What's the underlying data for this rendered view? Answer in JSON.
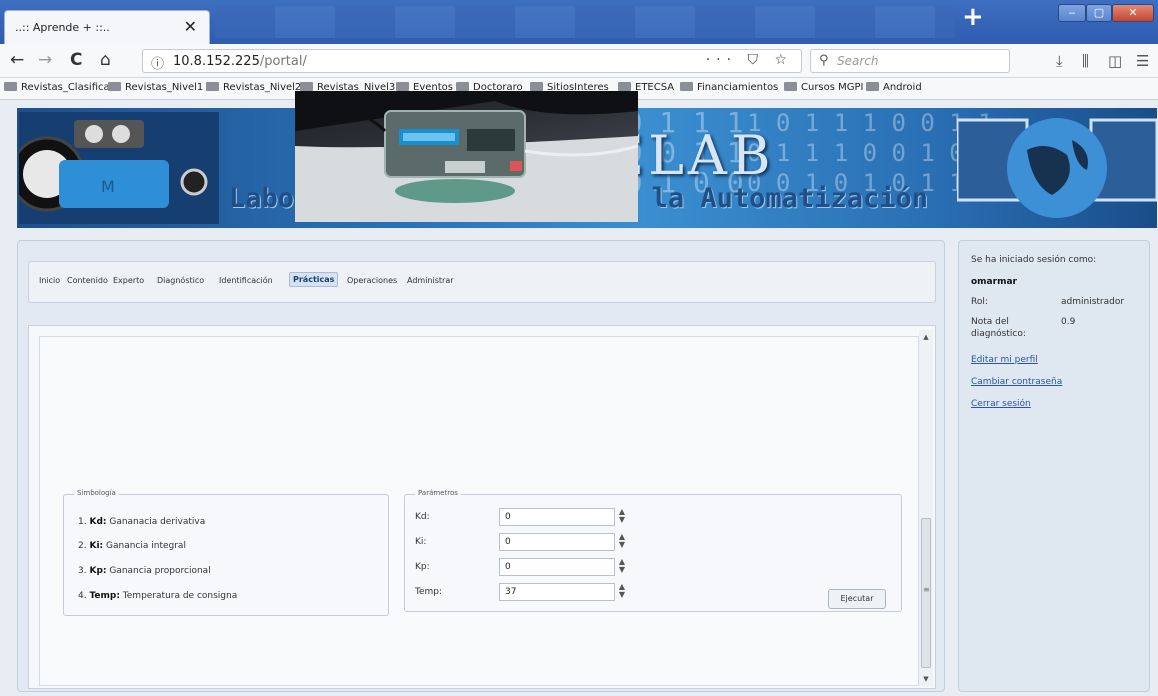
{
  "browser": {
    "tab_title": "..:: Aprende + ::..",
    "tab_close": "✕",
    "new_tab": "+",
    "window": {
      "minimize": "‒",
      "maximize": "▢",
      "close": "✕"
    },
    "nav": {
      "back": "←",
      "forward": "→",
      "reload": "C",
      "home": "⌂"
    },
    "url_host": "10.8.152.225",
    "url_path": "/portal/",
    "url_info": "ⓘ",
    "url_actions": "··· ⛉ ☆",
    "search_icon": "⚲",
    "search_placeholder": "Search",
    "toolbar_icons": {
      "download": "⤓",
      "library": "⫼",
      "sidebar": "◫",
      "menu": "☰"
    }
  },
  "bookmarks": [
    "Revistas_Clasificar",
    "Revistas_Nivel1",
    "Revistas_Nivel2",
    "Revistas_Nivel3",
    "Eventos",
    "Doctoraro",
    "SitiosInteres",
    "ETECSA",
    "Financiamientos",
    "Cursos MGPI",
    "Android"
  ],
  "banner": {
    "title": "REMOTELAB",
    "subtitle": "Laboratorios Remotos para la Automatización",
    "binary_rows": [
      "0 0 1 0 1 0 1 1 1",
      "1 0 1 1 1 0 0 1 1",
      "0 1 1 1 0 0 1 0 0"
    ]
  },
  "menu": [
    "Inicio",
    "Contenido",
    "Experto",
    "Diagnóstico",
    "Identificación",
    "Prácticas",
    "Operaciones",
    "Administrar"
  ],
  "menu_active": "Prácticas",
  "simbologia": {
    "legend": "Simbología",
    "items": [
      {
        "num": "1.",
        "key": "Kd:",
        "text": " Gananacia derivativa"
      },
      {
        "num": "2.",
        "key": "Ki:",
        "text": " Ganancia integral"
      },
      {
        "num": "3.",
        "key": "Kp:",
        "text": " Ganancia proporcional"
      },
      {
        "num": "4.",
        "key": "Temp:",
        "text": " Temperatura de consigna"
      }
    ]
  },
  "parametros": {
    "legend": "Parámetros",
    "fields": [
      {
        "label": "Kd:",
        "value": "0"
      },
      {
        "label": "Ki:",
        "value": "0"
      },
      {
        "label": "Kp:",
        "value": "0"
      },
      {
        "label": "Temp:",
        "value": "37"
      }
    ]
  },
  "execute_button": "Ejecutar",
  "session": {
    "logged_in_as": "Se ha iniciado sesión como:",
    "user": "omarmar",
    "role_label": "Rol:",
    "role_value": "administrador",
    "grade_label_1": "Nota del",
    "grade_label_2": "diagnóstico:",
    "grade_value": "0.9",
    "links": [
      "Editar mi perfil",
      "Cambiar contraseña",
      "Cerrar sesión"
    ]
  }
}
